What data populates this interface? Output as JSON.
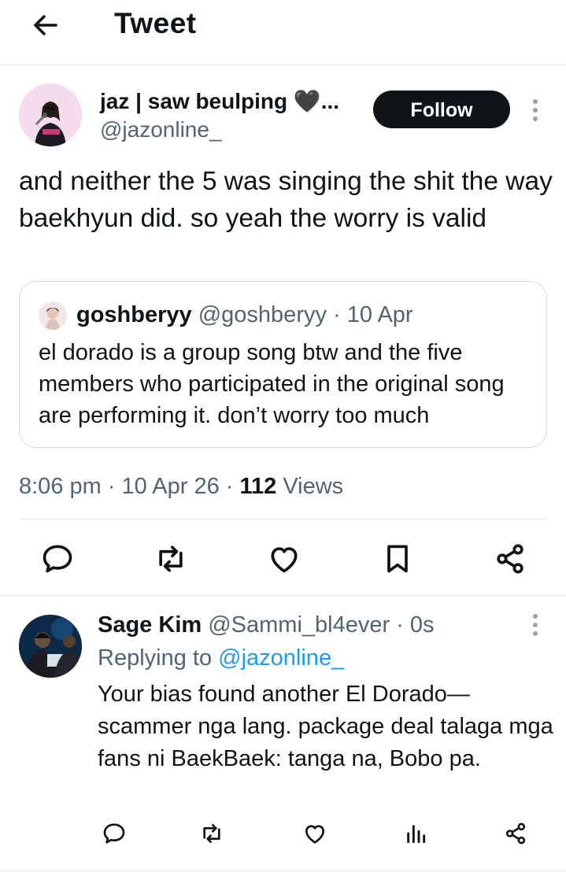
{
  "header": {
    "title": "Tweet"
  },
  "tweet": {
    "author_name": "jaz | saw beulping 🖤...",
    "author_handle": "@jazonline_",
    "follow_label": "Follow",
    "text": "and neither the 5 was singing the shit the way baekhyun did. so yeah the worry is valid",
    "quote": {
      "name": "goshberyy",
      "meta": "@goshberyy · 10 Apr",
      "text": "el dorado is a group song btw and the five members who participated in the original song are performing it. don’t worry too much"
    },
    "time": "8:06 pm · 10 Apr 26 · ",
    "views_count": "112",
    "views_label": " Views"
  },
  "actions": [
    "reply-icon",
    "retweet-icon",
    "like-icon",
    "bookmark-icon",
    "share-icon"
  ],
  "reply": {
    "name": "Sage Kim",
    "meta": "@Sammi_bl4ever · 0s",
    "replying_prefix": "Replying to ",
    "replying_handle": "@jazonline_",
    "text": "Your bias found another El Dorado— scammer nga lang. package deal talaga mga fans ni BaekBaek: tanga na, Bobo pa.",
    "actions": [
      "reply-icon",
      "retweet-icon",
      "like-icon",
      "views-icon",
      "share-icon"
    ]
  },
  "colors": {
    "text": "#0f1419",
    "muted": "#536471",
    "link": "#1d9bf0",
    "border": "#cfd9de"
  }
}
